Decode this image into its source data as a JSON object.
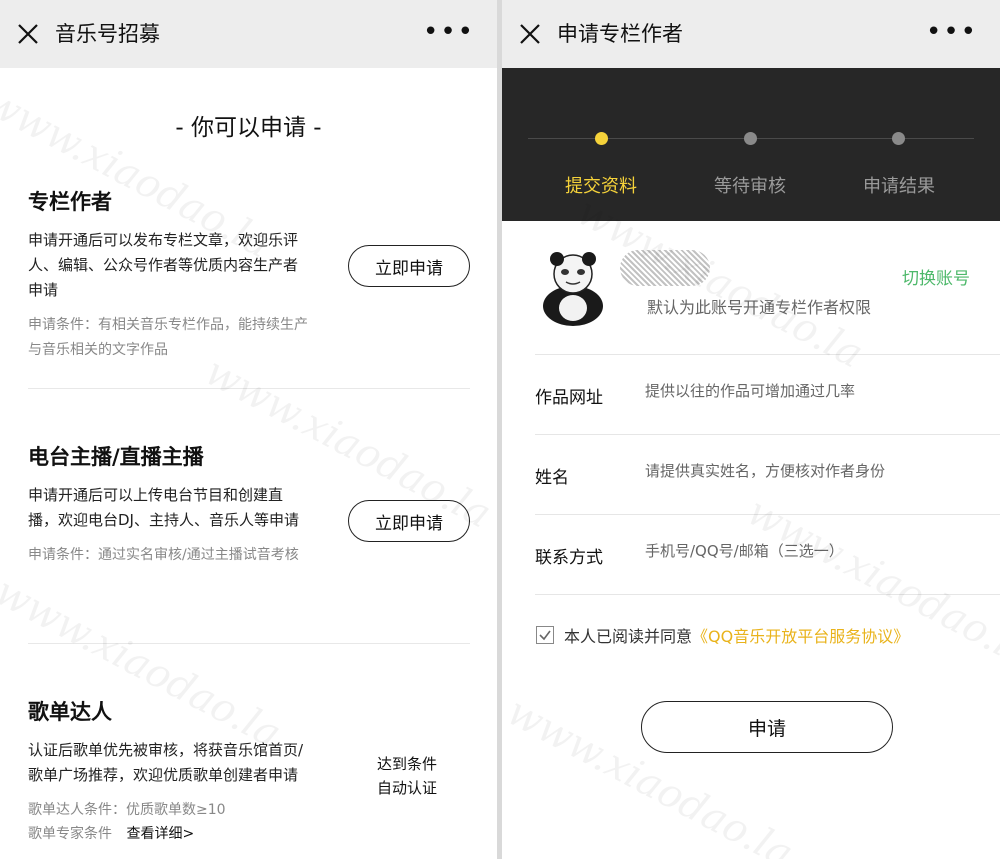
{
  "left": {
    "header": {
      "title": "音乐号招募",
      "close_icon": "close-icon",
      "more_icon": "more-icon",
      "more_glyph": "•••"
    },
    "heading": "- 你可以申请 -",
    "sections": [
      {
        "title": "专栏作者",
        "description": "申请开通后可以发布专栏文章，欢迎乐评人、编辑、公众号作者等优质内容生产者申请",
        "condition": "申请条件：有相关音乐专栏作品，能持续生产与音乐相关的文字作品",
        "button": "立即申请"
      },
      {
        "title": "电台主播/直播主播",
        "description": "申请开通后可以上传电台节目和创建直播，欢迎电台DJ、主持人、音乐人等申请",
        "condition": "申请条件：通过实名审核/通过主播试音考核",
        "button": "立即申请"
      },
      {
        "title": "歌单达人",
        "description": "认证后歌单优先被审核，将获音乐馆首页/歌单广场推荐，欢迎优质歌单创建者申请",
        "condition_1": "歌单达人条件：优质歌单数≥10",
        "condition_2_prefix": "歌单专家条件",
        "condition_2_link": "查看详细>",
        "auto_note_1": "达到条件",
        "auto_note_2": "自动认证"
      }
    ]
  },
  "right": {
    "header": {
      "title": "申请专栏作者",
      "close_icon": "close-icon",
      "more_icon": "more-icon",
      "more_glyph": "•••"
    },
    "steps": [
      {
        "label": "提交资料",
        "active": true
      },
      {
        "label": "等待审核",
        "active": false
      },
      {
        "label": "申请结果",
        "active": false
      }
    ],
    "account": {
      "switch_label": "切换账号",
      "default_note": "默认为此账号开通专栏作者权限"
    },
    "form": [
      {
        "label": "作品网址",
        "placeholder": "提供以往的作品可增加通过几率"
      },
      {
        "label": "姓名",
        "placeholder": "请提供真实姓名，方便核对作者身份"
      },
      {
        "label": "联系方式",
        "placeholder": "手机号/QQ号/邮箱（三选一）"
      }
    ],
    "agreement": {
      "checked": true,
      "text": "本人已阅读并同意",
      "link": "《QQ音乐开放平台服务协议》"
    },
    "submit_label": "申请"
  },
  "colors": {
    "accent_yellow": "#f5d23a",
    "link_green": "#4db86a",
    "link_gold": "#e9b31b",
    "steps_bg": "#272727"
  },
  "watermark": "www.xiaodao.la"
}
